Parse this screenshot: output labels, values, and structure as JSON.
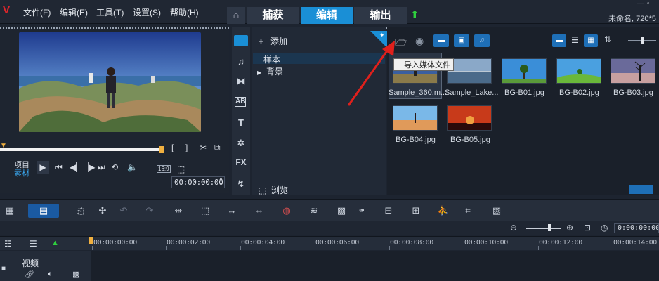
{
  "menu": {
    "items": [
      "文件(F)",
      "编辑(E)",
      "工具(T)",
      "设置(S)",
      "帮助(H)"
    ]
  },
  "modes": {
    "capture": "捕获",
    "edit": "编辑",
    "share": "输出",
    "active": "编辑"
  },
  "project_info": "未命名, 720*5",
  "player": {
    "project_label": "项目",
    "clip_label": "素材",
    "timecode": "00:00:00:00",
    "aspect": "16:9",
    "mark_in": "[",
    "mark_out": "]"
  },
  "library": {
    "add_label": "添加",
    "tree": [
      "样本",
      "背景"
    ],
    "browse_label": "浏览",
    "tooltip": "导入媒体文件",
    "thumbnails": [
      {
        "label": "Sample_360.m..."
      },
      {
        "label": "Sample_Lake..."
      },
      {
        "label": "BG-B01.jpg"
      },
      {
        "label": "BG-B02.jpg"
      },
      {
        "label": "BG-B03.jpg"
      },
      {
        "label": "BG-B04.jpg"
      },
      {
        "label": "BG-B05.jpg"
      }
    ]
  },
  "timeline": {
    "zoom_timecode": "0:00:00:00",
    "ruler": [
      "00:00:00:00",
      "00:00:02:00",
      "00:00:04:00",
      "00:00:06:00",
      "00:00:08:00",
      "00:00:10:00",
      "00:00:12:00",
      "00:00:14:00"
    ],
    "track_label": "视频"
  },
  "colors": {
    "accent": "#1a8fd6",
    "annotation_arrow": "#e0201c",
    "upload": "#2fcf3e"
  }
}
